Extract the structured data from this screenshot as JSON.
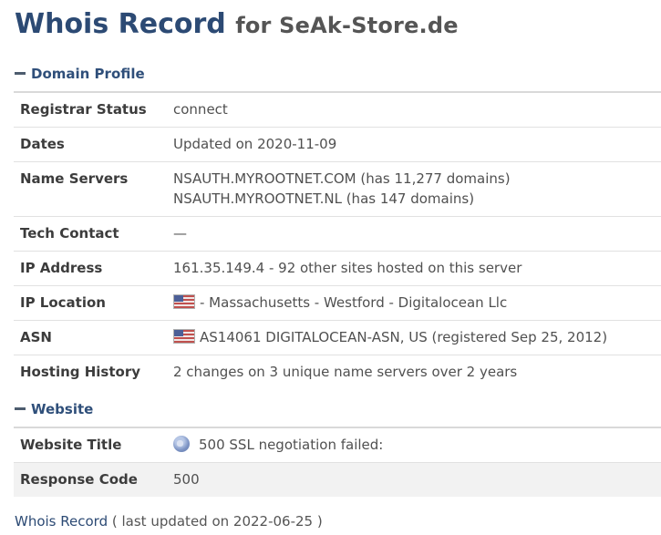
{
  "header": {
    "title_main": "Whois Record",
    "title_sub": "for SeAk-Store.de"
  },
  "domain_profile": {
    "heading": "Domain Profile",
    "rows": [
      {
        "label": "Registrar Status",
        "lines": [
          "connect"
        ]
      },
      {
        "label": "Dates",
        "lines": [
          "Updated on 2020-11-09"
        ]
      },
      {
        "label": "Name Servers",
        "lines": [
          "NSAUTH.MYROOTNET.COM (has 11,277 domains)",
          "NSAUTH.MYROOTNET.NL (has 147 domains)"
        ]
      },
      {
        "label": "Tech Contact",
        "lines": [
          "—"
        ]
      },
      {
        "label": "IP Address",
        "lines": [
          "161.35.149.4 - 92 other sites hosted on this server"
        ]
      },
      {
        "label": "IP Location",
        "lines": [
          "- Massachusetts - Westford - Digitalocean Llc"
        ],
        "icon": "us-flag-icon"
      },
      {
        "label": "ASN",
        "lines": [
          "AS14061 DIGITALOCEAN-ASN, US (registered Sep 25, 2012)"
        ],
        "icon": "us-flag-icon"
      },
      {
        "label": "Hosting History",
        "lines": [
          "2 changes on 3 unique name servers over 2 years"
        ]
      }
    ]
  },
  "website": {
    "heading": "Website",
    "rows": [
      {
        "label": "Website Title",
        "lines": [
          "500 SSL negotiation failed:"
        ],
        "icon": "globe-icon"
      },
      {
        "label": "Response Code",
        "lines": [
          "500"
        ]
      }
    ]
  },
  "footer": {
    "link": "Whois Record",
    "meta": "( last updated on 2022-06-25 )"
  }
}
